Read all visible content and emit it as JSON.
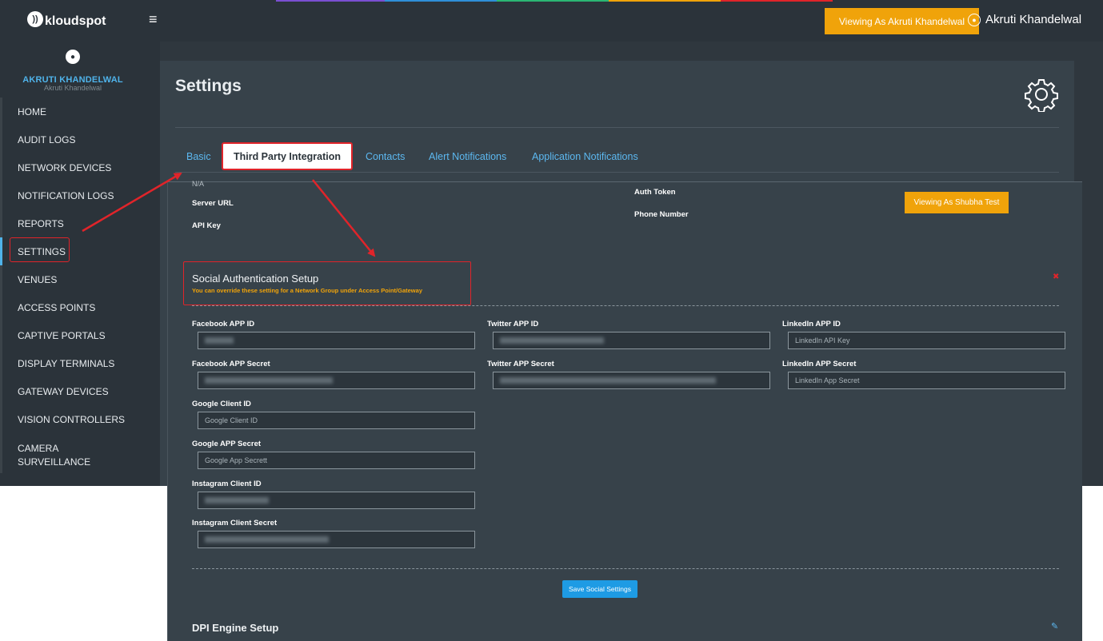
{
  "header": {
    "logo_text": "kloudspot",
    "viewing_as_label": "Viewing As Akruti Khandelwal",
    "user_name": "Akruti Khandelwal",
    "stripe_colors": [
      "#7a4fd1",
      "#2f8fd8",
      "#2bb673",
      "#f0a30a",
      "#e0242a"
    ]
  },
  "sidebar": {
    "user_name": "AKRUTI KHANDELWAL",
    "user_sub": "Akruti Khandelwal",
    "items": [
      {
        "label": "HOME"
      },
      {
        "label": "AUDIT LOGS"
      },
      {
        "label": "NETWORK DEVICES"
      },
      {
        "label": "NOTIFICATION LOGS"
      },
      {
        "label": "REPORTS"
      },
      {
        "label": "SETTINGS"
      },
      {
        "label": "VENUES"
      },
      {
        "label": "ACCESS POINTS"
      },
      {
        "label": "CAPTIVE PORTALS"
      },
      {
        "label": "DISPLAY TERMINALS"
      },
      {
        "label": "GATEWAY DEVICES"
      },
      {
        "label": "VISION CONTROLLERS"
      },
      {
        "label": "CAMERA SURVEILLANCE"
      }
    ]
  },
  "page": {
    "title": "Settings",
    "tabs": [
      {
        "label": "Basic"
      },
      {
        "label": "Third Party Integration"
      },
      {
        "label": "Contacts"
      },
      {
        "label": "Alert Notifications"
      },
      {
        "label": "Application Notifications"
      }
    ]
  },
  "twilio": {
    "na": "N/A",
    "server_url_label": "Server URL",
    "api_key_label": "API Key",
    "auth_token_label": "Auth Token",
    "phone_number_label": "Phone Number",
    "viewing_as_label": "Viewing As Shubha Test"
  },
  "social": {
    "title": "Social Authentication Setup",
    "subtitle": "You can override these setting for a Network Group under Access Point/Gateway",
    "close_glyph": "✖",
    "facebook_app_id_label": "Facebook APP ID",
    "facebook_app_secret_label": "Facebook APP Secret",
    "twitter_app_id_label": "Twitter APP ID",
    "twitter_app_secret_label": "Twitter APP Secret",
    "linkedin_app_id_label": "LinkedIn APP ID",
    "linkedin_app_id_placeholder": "LinkedIn API Key",
    "linkedin_app_secret_label": "LinkedIn APP Secret",
    "linkedin_app_secret_placeholder": "LinkedIn App Secret",
    "google_client_id_label": "Google Client ID",
    "google_client_id_placeholder": "Google Client ID",
    "google_app_secret_label": "Google APP Secret",
    "google_app_secret_placeholder": "Google App Secrett",
    "instagram_client_id_label": "Instagram Client ID",
    "instagram_client_secret_label": "Instagram Client Secret",
    "save_label": "Save Social Settings"
  },
  "dpi": {
    "title": "DPI Engine Setup"
  },
  "colors": {
    "accent": "#4fb3ea",
    "warning": "#f0a30a",
    "annotation_red": "#e0242a",
    "panel": "#37424a",
    "sidebar": "#2b333a"
  }
}
